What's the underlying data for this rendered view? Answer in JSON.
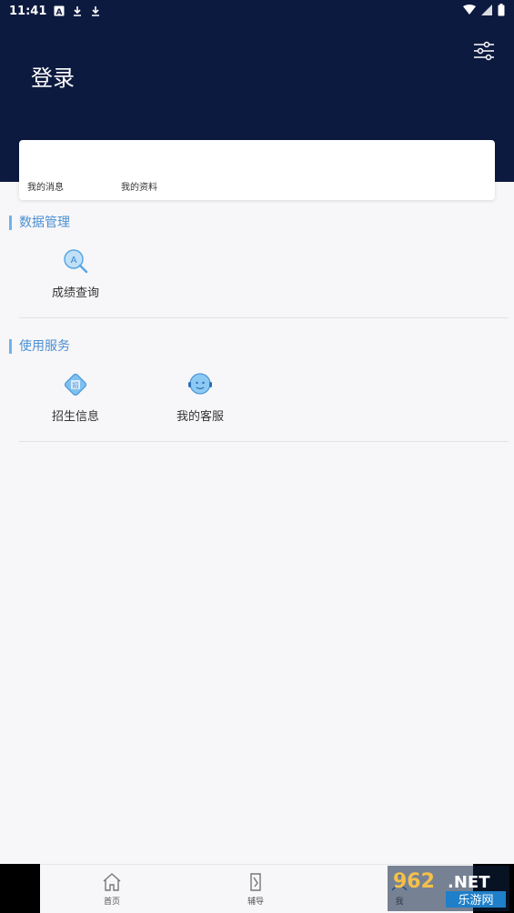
{
  "status_bar": {
    "time": "11:41"
  },
  "header": {
    "title": "登录"
  },
  "profile_card": {
    "messages_label": "我的消息",
    "profile_label": "我的资料"
  },
  "sections": [
    {
      "title": "数据管理",
      "items": [
        {
          "label": "成绩查询",
          "icon": "score-search-icon"
        }
      ]
    },
    {
      "title": "使用服务",
      "items": [
        {
          "label": "招生信息",
          "icon": "enrollment-info-icon"
        },
        {
          "label": "我的客服",
          "icon": "customer-service-icon"
        }
      ]
    }
  ],
  "bottom_nav": [
    {
      "label": "首页",
      "icon": "home-icon"
    },
    {
      "label": "辅导",
      "icon": "tutoring-icon"
    },
    {
      "label": "我",
      "icon": "me-icon"
    }
  ],
  "watermark": {
    "text_top": "962.NET",
    "text_bottom": "乐游网"
  },
  "colors": {
    "header_bg": "#0d1a3f",
    "accent": "#4d8fd1",
    "page_bg": "#f7f7f9"
  }
}
